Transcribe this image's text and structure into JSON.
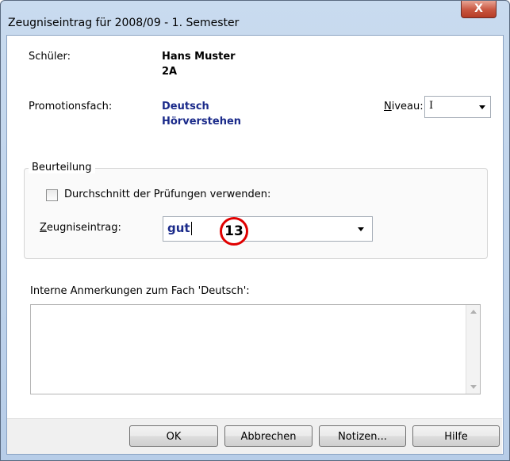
{
  "window": {
    "title": "Zeugniseintrag für 2008/09 - 1. Semester",
    "close_glyph": "X"
  },
  "student": {
    "label": "Schüler:",
    "name": "Hans Muster",
    "class": "2A"
  },
  "subject": {
    "label": "Promotionsfach:",
    "name": "Deutsch",
    "sub": "Hörverstehen"
  },
  "niveau": {
    "label_underlined": "N",
    "label_rest": "iveau:",
    "value": "I"
  },
  "assessment": {
    "group_title": "Beurteilung",
    "checkbox_label": "Durchschnitt der Prüfungen verwenden:",
    "checkbox_checked": false,
    "entry_label_underlined": "Z",
    "entry_label_rest": "eugniseintrag:",
    "entry_value": "gut"
  },
  "annotation_badge": "13",
  "notes": {
    "label": "Interne Anmerkungen zum Fach 'Deutsch':",
    "value": ""
  },
  "buttons": {
    "ok": "OK",
    "cancel": "Abbrechen",
    "notes": "Notizen...",
    "help": "Hilfe"
  },
  "colors": {
    "accent_text": "#1a2a8a",
    "badge_border": "#e00000",
    "close_button": "#c8553f"
  }
}
